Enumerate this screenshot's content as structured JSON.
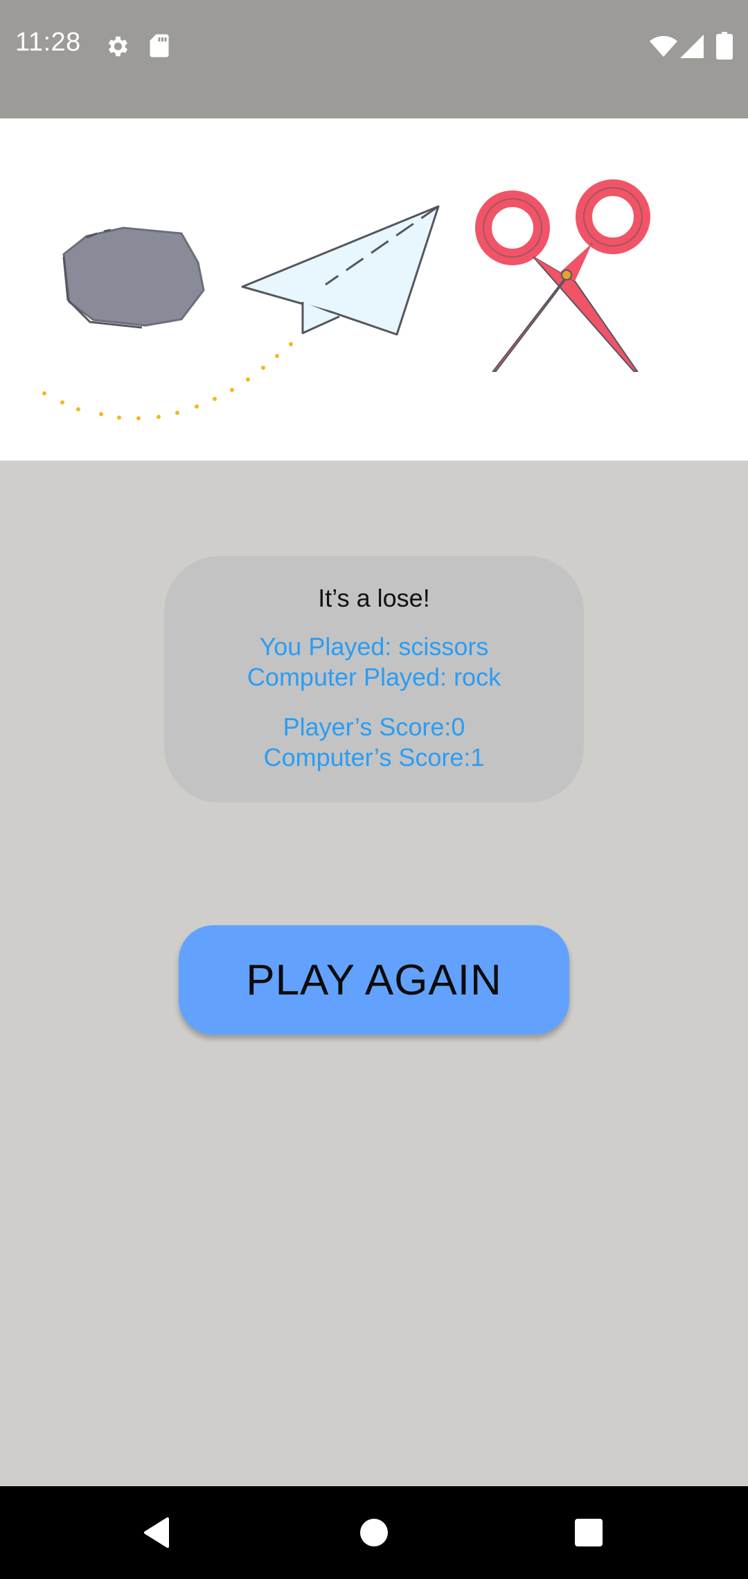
{
  "status_bar": {
    "time": "11:28",
    "icons": [
      "gear-icon",
      "sd-card-icon",
      "wifi-icon",
      "cell-signal-icon",
      "battery-icon"
    ]
  },
  "banner": {
    "items": [
      "rock",
      "paper",
      "scissors"
    ]
  },
  "result": {
    "title": "It’s a lose!",
    "you_played": "You Played: scissors",
    "computer_played": "Computer Played: rock",
    "player_score": "Player’s Score:0",
    "computer_score": "Computer’s Score:1"
  },
  "play_button": {
    "label": "PLAY AGAIN"
  },
  "nav_bar": {
    "buttons": [
      "back-icon",
      "home-icon",
      "recents-icon"
    ]
  },
  "colors": {
    "status_bar": "#9c9b97",
    "background": "#cfceca",
    "card": "#c3c3c3",
    "result_text": "#2a9df4",
    "button": "#62a2fe"
  }
}
